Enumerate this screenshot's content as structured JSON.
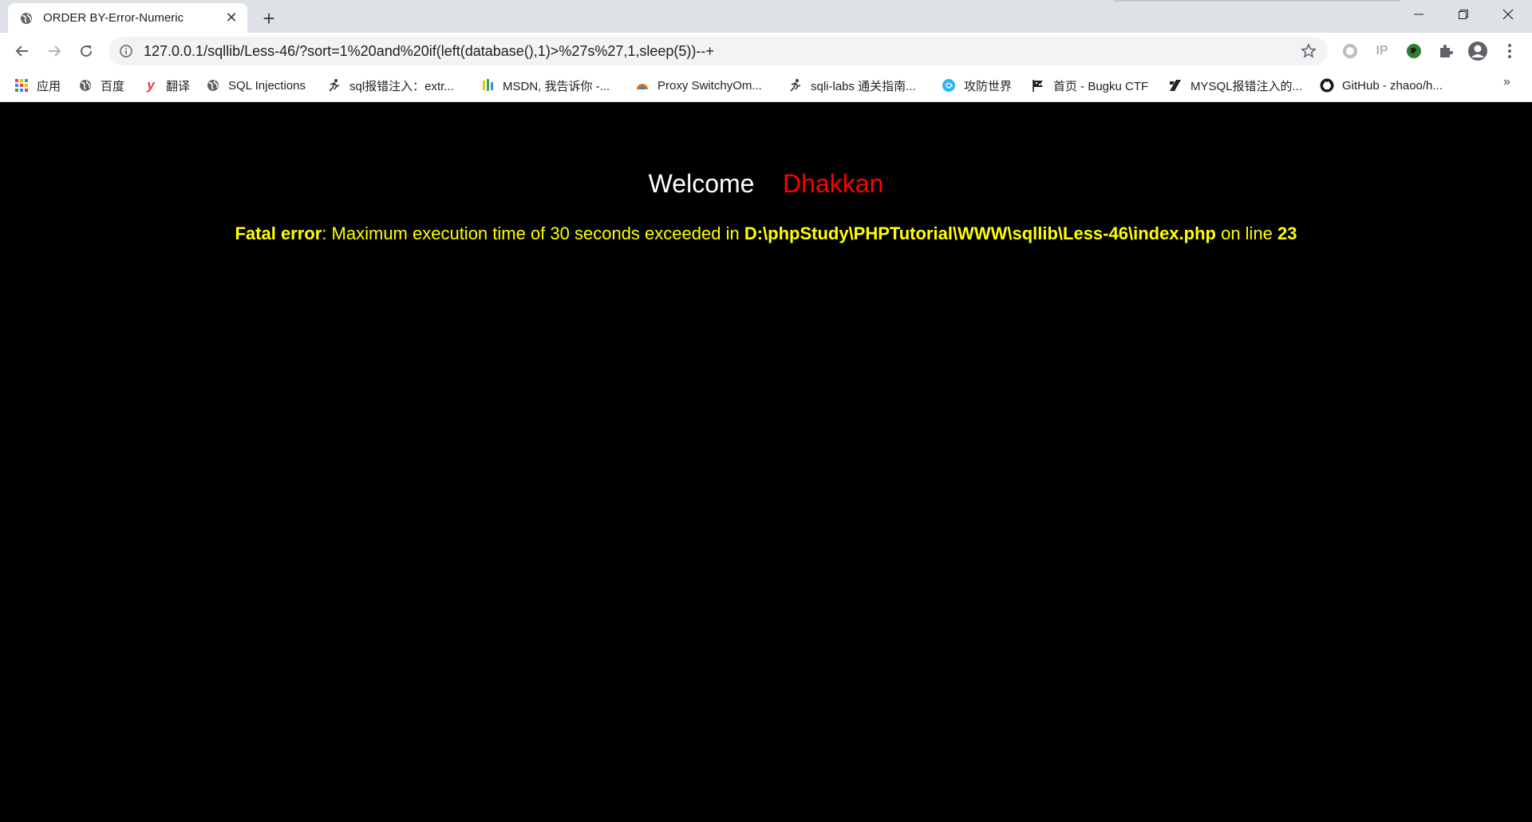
{
  "browser": {
    "tab": {
      "title": "ORDER BY-Error-Numeric",
      "favicon": "globe-icon",
      "close_label": "✕"
    },
    "new_tab_label": "+",
    "window_controls": {
      "minimize": "—",
      "maximize": "❐",
      "close": "✕"
    },
    "address_bar": {
      "url": "127.0.0.1/sqllib/Less-46/?sort=1%20and%20if(left(database(),1)>%27s%27,1,sleep(5))--+"
    },
    "extensions": [
      {
        "name": "record-icon"
      },
      {
        "name": "ip-extension",
        "label": "IP"
      },
      {
        "name": "green-extension-icon"
      },
      {
        "name": "puzzle-icon"
      },
      {
        "name": "profile-icon"
      },
      {
        "name": "menu-icon"
      }
    ],
    "bookmarks": [
      {
        "label": "应用",
        "icon": "apps-icon"
      },
      {
        "label": "百度",
        "icon": "globe-icon"
      },
      {
        "label": "翻译",
        "icon": "youdao-icon",
        "glyph": "y"
      },
      {
        "label": "SQL Injections",
        "icon": "globe-icon"
      },
      {
        "label": "sql报错注入：extr...",
        "icon": "runner-icon"
      },
      {
        "label": "MSDN, 我告诉你 -...",
        "icon": "msdn-icon"
      },
      {
        "label": "Proxy SwitchyOm...",
        "icon": "switchy-icon"
      },
      {
        "label": "sqli-labs 通关指南...",
        "icon": "runner-icon"
      },
      {
        "label": "攻防世界",
        "icon": "swirl-icon"
      },
      {
        "label": "首页 - Bugku CTF",
        "icon": "flag-icon"
      },
      {
        "label": "MYSQL报错注入的...",
        "icon": "slash-icon"
      },
      {
        "label": "GitHub - zhaoo/h...",
        "icon": "github-icon"
      }
    ],
    "bookmarks_more": "»"
  },
  "page": {
    "welcome_label": "Welcome",
    "welcome_name": "Dhakkan",
    "error": {
      "prefix": "Fatal error",
      "message": ": Maximum execution time of 30 seconds exceeded in ",
      "path": "D:\\phpStudy\\PHPTutorial\\WWW\\sqllib\\Less-46\\index.php",
      "on_line": " on line ",
      "line": "23"
    }
  },
  "colors": {
    "page_background": "#000000",
    "welcome_text": "#ffffff",
    "name_text": "#ff0000",
    "error_text": "#ffff00"
  }
}
